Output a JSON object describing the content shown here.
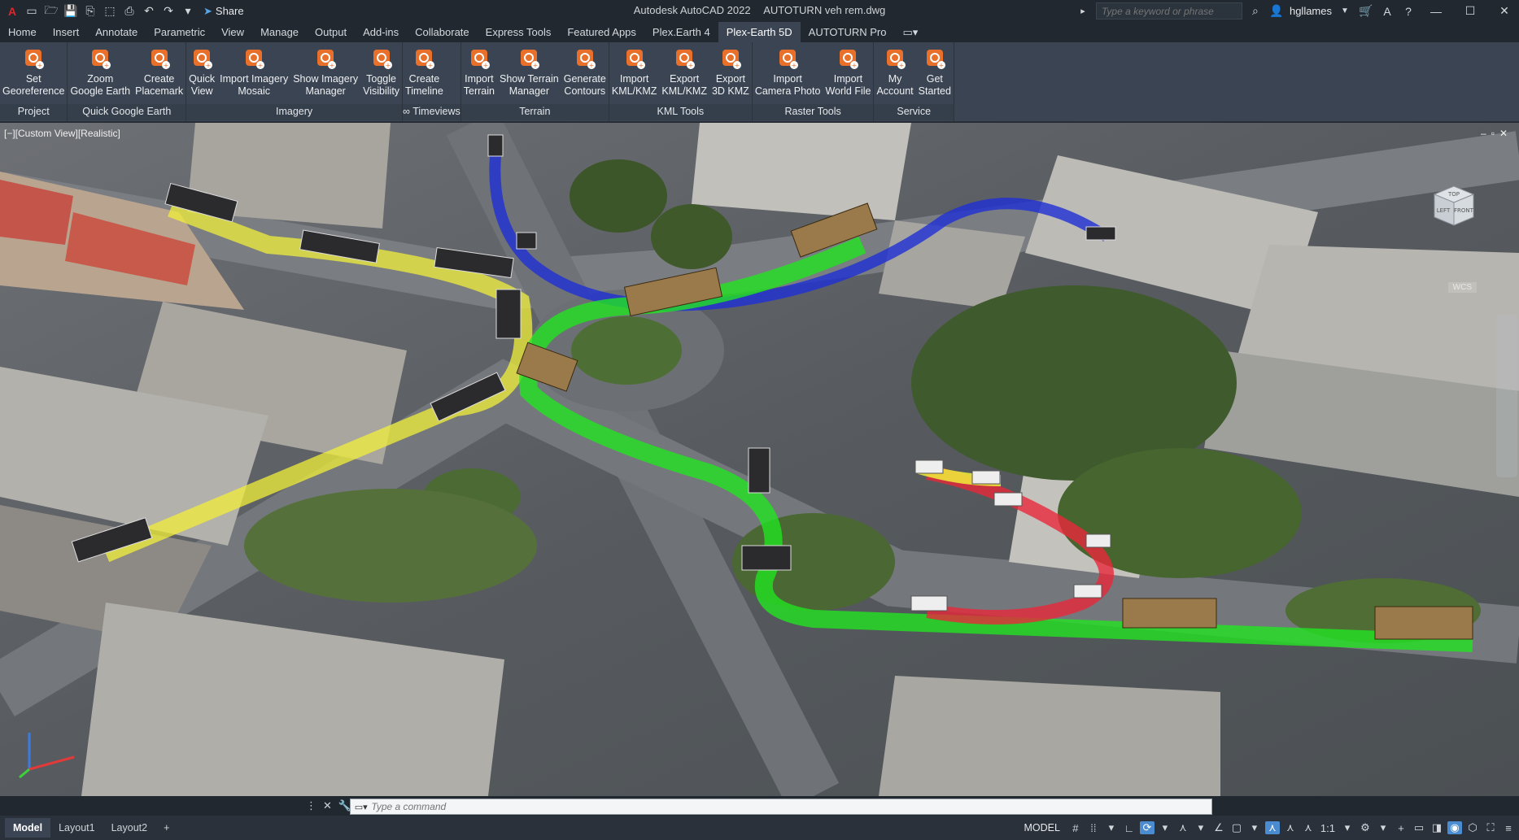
{
  "titlebar": {
    "app_title": "Autodesk AutoCAD 2022",
    "file_title": "AUTOTURN veh rem.dwg",
    "share_label": "Share",
    "search_placeholder": "Type a keyword or phrase",
    "username": "hgllames"
  },
  "tabs": [
    {
      "label": "Home"
    },
    {
      "label": "Insert"
    },
    {
      "label": "Annotate"
    },
    {
      "label": "Parametric"
    },
    {
      "label": "View"
    },
    {
      "label": "Manage"
    },
    {
      "label": "Output"
    },
    {
      "label": "Add-ins"
    },
    {
      "label": "Collaborate"
    },
    {
      "label": "Express Tools"
    },
    {
      "label": "Featured Apps"
    },
    {
      "label": "Plex.Earth 4"
    },
    {
      "label": "Plex-Earth 5D"
    },
    {
      "label": "AUTOTURN Pro"
    }
  ],
  "active_tab": "Plex-Earth 5D",
  "ribbon": {
    "panels": [
      {
        "label": "Project",
        "tools": [
          {
            "label": "Set\nGeoreference",
            "icon": "georeference-icon"
          }
        ]
      },
      {
        "label": "Quick Google Earth",
        "tools": [
          {
            "label": "Zoom\nGoogle Earth",
            "icon": "zoom-google-earth-icon"
          },
          {
            "label": "Create\nPlacemark",
            "icon": "placemark-icon"
          }
        ]
      },
      {
        "label": "Imagery",
        "tools": [
          {
            "label": "Quick\nView",
            "icon": "quick-view-icon"
          },
          {
            "label": "Import Imagery\nMosaic",
            "icon": "mosaic-icon"
          },
          {
            "label": "Show Imagery\nManager",
            "icon": "imagery-manager-icon"
          },
          {
            "label": "Toggle\nVisibility",
            "icon": "visibility-icon"
          }
        ]
      },
      {
        "label": "∞ Timeviews",
        "tools": [
          {
            "label": "Create\nTimeline",
            "icon": "timeline-icon"
          }
        ]
      },
      {
        "label": "Terrain",
        "tools": [
          {
            "label": "Import\nTerrain",
            "icon": "import-terrain-icon"
          },
          {
            "label": "Show Terrain\nManager",
            "icon": "terrain-manager-icon"
          },
          {
            "label": "Generate\nContours",
            "icon": "contours-icon"
          }
        ]
      },
      {
        "label": "KML Tools",
        "tools": [
          {
            "label": "Import\nKML/KMZ",
            "icon": "import-kml-icon"
          },
          {
            "label": "Export\nKML/KMZ",
            "icon": "export-kml-icon"
          },
          {
            "label": "Export\n3D KMZ",
            "icon": "export-3d-kmz-icon"
          }
        ]
      },
      {
        "label": "Raster Tools",
        "tools": [
          {
            "label": "Import\nCamera Photo",
            "icon": "camera-photo-icon"
          },
          {
            "label": "Import\nWorld File",
            "icon": "world-file-icon"
          }
        ]
      },
      {
        "label": "Service",
        "tools": [
          {
            "label": "My\nAccount",
            "icon": "account-icon"
          },
          {
            "label": "Get\nStarted",
            "icon": "play-icon"
          }
        ]
      }
    ]
  },
  "viewport": {
    "label": "[−][Custom View][Realistic]",
    "viewcube_labels": {
      "top": "TOP",
      "left": "LEFT",
      "front": "FRONT"
    },
    "wcs_label": "WCS"
  },
  "command_line": {
    "placeholder": "Type a command"
  },
  "layouts": [
    {
      "label": "Model"
    },
    {
      "label": "Layout1"
    },
    {
      "label": "Layout2"
    }
  ],
  "status": {
    "model_label": "MODEL",
    "scale": "1:1"
  },
  "colors": {
    "accent": "#e8702a",
    "path_yellow": "#f2ef3a",
    "path_green": "#22e322",
    "path_blue": "#1f2fd6",
    "path_red": "#e8283a",
    "ribbon_bg": "#3b4453"
  }
}
